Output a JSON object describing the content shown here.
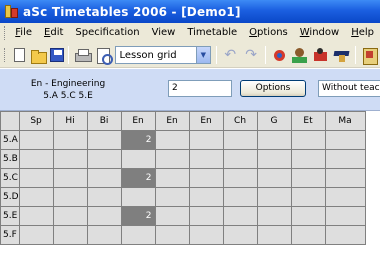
{
  "window": {
    "title": "aSc Timetables 2006  - [Demo1]"
  },
  "menu": [
    {
      "label": "File",
      "u": "F",
      "rest": "ile"
    },
    {
      "label": "Edit",
      "u": "E",
      "rest": "dit"
    },
    {
      "label": "Specification",
      "u": "",
      "rest": "Specification"
    },
    {
      "label": "View",
      "u": "",
      "rest": "View"
    },
    {
      "label": "Timetable",
      "u": "",
      "rest": "Timetable"
    },
    {
      "label": "Options",
      "u": "O",
      "rest": "ptions"
    },
    {
      "label": "Window",
      "u": "W",
      "rest": "indow"
    },
    {
      "label": "Help",
      "u": "H",
      "rest": "elp"
    }
  ],
  "toolbar": {
    "view_select": "Lesson grid",
    "icons": [
      "new-icon",
      "open-icon",
      "save-icon",
      "print-icon",
      "print-preview-icon",
      "undo-icon",
      "redo-icon",
      "generate-icon",
      "teacher-icon",
      "classroom-icon",
      "class-icon",
      "subject-icon"
    ]
  },
  "info": {
    "subject_line": "En - Engineering",
    "classes_line": "5.A 5.C 5.E",
    "count_value": "2",
    "options_label": "Options",
    "teacher_filter": "Without teacher"
  },
  "grid": {
    "columns": [
      "Sp",
      "Hi",
      "Bi",
      "En",
      "En",
      "En",
      "Ch",
      "G",
      "Et",
      "Ma"
    ],
    "rows": [
      {
        "label": "5.A",
        "cells": [
          "",
          "",
          "",
          "2",
          "",
          "",
          "",
          "",
          "",
          ""
        ]
      },
      {
        "label": "5.B",
        "cells": [
          "",
          "",
          "",
          "",
          "",
          "",
          "",
          "",
          "",
          ""
        ]
      },
      {
        "label": "5.C",
        "cells": [
          "",
          "",
          "",
          "2",
          "",
          "",
          "",
          "",
          "",
          ""
        ]
      },
      {
        "label": "5.D",
        "cells": [
          "",
          "",
          "",
          "",
          "",
          "",
          "",
          "",
          "",
          ""
        ]
      },
      {
        "label": "5.E",
        "cells": [
          "",
          "",
          "",
          "2",
          "",
          "",
          "",
          "",
          "",
          ""
        ]
      },
      {
        "label": "5.F",
        "cells": [
          "",
          "",
          "",
          "",
          "",
          "",
          "",
          "",
          "",
          ""
        ]
      }
    ]
  }
}
